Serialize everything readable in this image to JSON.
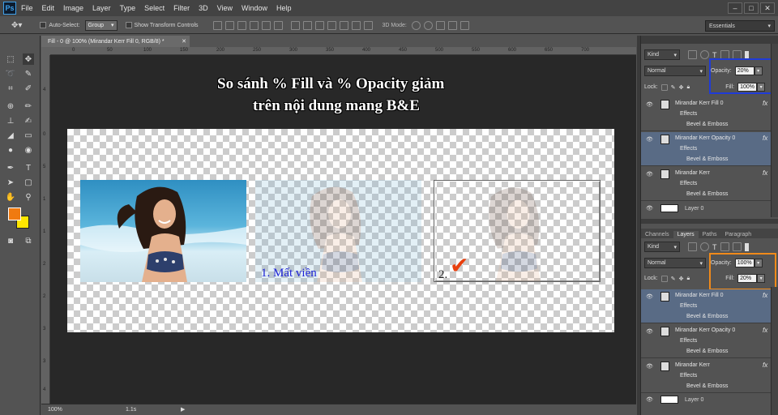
{
  "app": {
    "logo": "Ps"
  },
  "menu": [
    "File",
    "Edit",
    "Image",
    "Layer",
    "Type",
    "Select",
    "Filter",
    "3D",
    "View",
    "Window",
    "Help"
  ],
  "window_controls": [
    "–",
    "□",
    "✕"
  ],
  "options": {
    "auto_select_label": "Auto-Select:",
    "auto_select_value": "Group",
    "transform_label": "Show Transform Controls",
    "mode_3d_label": "3D Mode:",
    "workspace": "Essentials"
  },
  "document": {
    "tab_title": "Fill - 0 @ 100% (Mirandar Kerr Fill 0, RGB/8) *",
    "title_line1": "So sánh % Fill và % Opacity giảm",
    "title_line2": "trên nội dung mang B&E",
    "label1": "1. Mất viền",
    "label2": "2.",
    "check_mark": "✔"
  },
  "ruler_h": [
    "0",
    "50",
    "100",
    "150",
    "200",
    "250",
    "300",
    "350",
    "400",
    "450",
    "500",
    "550",
    "600",
    "650",
    "700"
  ],
  "ruler_v": [
    "0",
    "5",
    "1",
    "1",
    "2",
    "2",
    "3",
    "3",
    "4",
    "4"
  ],
  "status": {
    "zoom": "100%",
    "timing": "1.1s"
  },
  "panel_top": {
    "kind": "Kind",
    "blend": "Normal",
    "opacity_label": "Opacity:",
    "opacity_value": "20%",
    "lock_label": "Lock:",
    "fill_label": "Fill:",
    "fill_value": "100%",
    "layers": [
      {
        "name": "Mirandar Kerr Fill 0",
        "fx": "fx",
        "effects": "Effects",
        "effect": "Bevel & Emboss"
      },
      {
        "name": "Mirandar Kerr Opacity 0",
        "fx": "fx",
        "effects": "Effects",
        "effect": "Bevel & Emboss"
      },
      {
        "name": "Mirandar Kerr",
        "fx": "fx",
        "effects": "Effects",
        "effect": "Bevel & Emboss"
      }
    ],
    "bg_layer": "Layer 0"
  },
  "panel_bottom": {
    "tabs": [
      "Channels",
      "Layers",
      "Paths",
      "Paragraph"
    ],
    "kind": "Kind",
    "blend": "Normal",
    "opacity_label": "Opacity:",
    "opacity_value": "100%",
    "lock_label": "Lock:",
    "fill_label": "Fill:",
    "fill_value": "20%",
    "layers": [
      {
        "name": "Mirandar Kerr Fill 0",
        "fx": "fx",
        "effects": "Effects",
        "effect": "Bevel & Emboss"
      },
      {
        "name": "Mirandar Kerr Opacity 0",
        "fx": "fx",
        "effects": "Effects",
        "effect": "Bevel & Emboss"
      },
      {
        "name": "Mirandar Kerr",
        "fx": "fx",
        "effects": "Effects",
        "effect": "Bevel & Emboss"
      }
    ],
    "bg_layer": "Layer 0"
  },
  "colors": {
    "foreground": "#f07a10",
    "background": "#ffe600",
    "highlight_blue": "#1f3bd8",
    "highlight_orange": "#f08a1a",
    "label_blue": "#1d22d6",
    "check_red": "#e8400e",
    "selected_layer": "#596b85"
  }
}
